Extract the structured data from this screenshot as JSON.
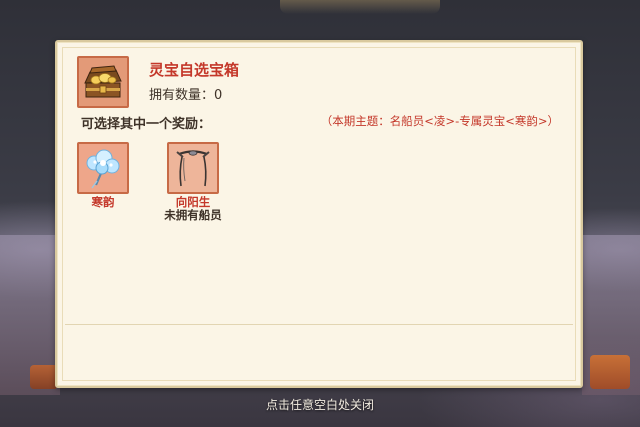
{
  "item": {
    "icon": "treasure-chest-icon",
    "title": "灵宝自选宝箱",
    "count_label": "拥有数量：",
    "count_value": "0"
  },
  "choose_label": "可选择其中一个奖励：",
  "theme_text": "（本期主题：名船员<凌>-专属灵宝<寒韵>）",
  "rewards": [
    {
      "name": "寒韵",
      "subtitle": "",
      "icon": "blue-flower-fan-icon"
    },
    {
      "name": "向阳生",
      "subtitle": "未拥有船员",
      "icon": "hair-band-icon"
    }
  ],
  "close_hint": "点击任意空白处关闭",
  "colors": {
    "accent_red": "#c4382a",
    "panel_bg": "#fbf5e6",
    "icon_frame": "#eea68a"
  }
}
